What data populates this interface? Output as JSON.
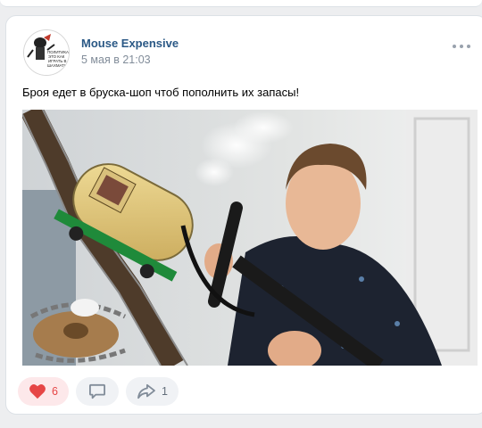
{
  "post": {
    "author": "Mouse Expensive",
    "date": "5 мая в 21:03",
    "text": "Броя едет в бруска-шоп чтоб пополнить их запасы!",
    "avatar_caption": [
      "ПОЛИТИКА",
      "ЭТО КАК",
      "ИГРАТЬ В",
      "ШАХМАТЫ"
    ]
  },
  "actions": {
    "likes": "6",
    "reposts": "1"
  },
  "colors": {
    "author_link": "#2a5885",
    "like_active": "#e64646",
    "background": "#edeef0"
  },
  "icons": [
    "more-icon",
    "heart-icon",
    "comment-icon",
    "share-icon"
  ]
}
